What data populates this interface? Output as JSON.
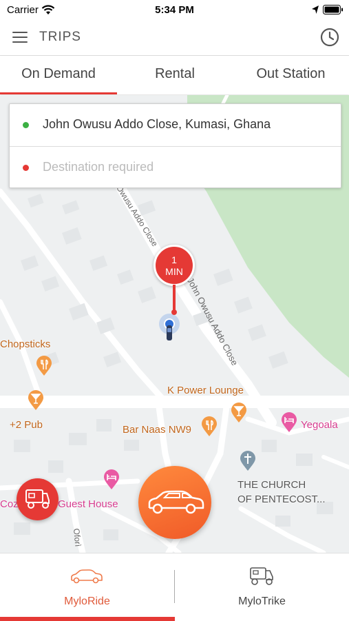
{
  "status_bar": {
    "carrier": "Carrier",
    "time": "5:34 PM"
  },
  "header": {
    "title": "TRIPS",
    "menu_icon": "hamburger-menu-icon",
    "history_icon": "clock-history-icon"
  },
  "tabs": [
    {
      "label": "On Demand",
      "active": true
    },
    {
      "label": "Rental",
      "active": false
    },
    {
      "label": "Out Station",
      "active": false
    }
  ],
  "trip": {
    "pickup": "John Owusu Addo Close, Kumasi, Ghana",
    "pickup_color": "#3cb043",
    "destination_placeholder": "Destination required",
    "destination_color": "#e53935"
  },
  "eta": {
    "value": "1",
    "unit": "MIN"
  },
  "map": {
    "streets": [
      "Owusu Addo Close",
      "John Owusu Addo Close",
      "Oforì"
    ],
    "places": [
      {
        "name": "Chopsticks",
        "type": "restaurant"
      },
      {
        "name": "+2 Pub",
        "type": "bar"
      },
      {
        "name": "K Power Lounge",
        "type": "bar"
      },
      {
        "name": "Bar Naas NW9",
        "type": "restaurant"
      },
      {
        "name": "Yegoala",
        "type": "hotel"
      },
      {
        "name": "THE CHURCH OF PENTECOST...",
        "line1": "THE CHURCH",
        "line2": "OF PENTECOST...",
        "type": "church"
      },
      {
        "name": "Cozy Guest House",
        "left": "Cozy",
        "right": "Guest House",
        "type": "hotel"
      }
    ]
  },
  "bottom_nav": [
    {
      "label": "MyloRide",
      "icon": "car-icon",
      "active": true
    },
    {
      "label": "MyloTrike",
      "icon": "tricycle-icon",
      "active": false
    }
  ],
  "colors": {
    "accent": "#e53935",
    "orange": "#f47a34",
    "park": "#c9e6c6"
  }
}
